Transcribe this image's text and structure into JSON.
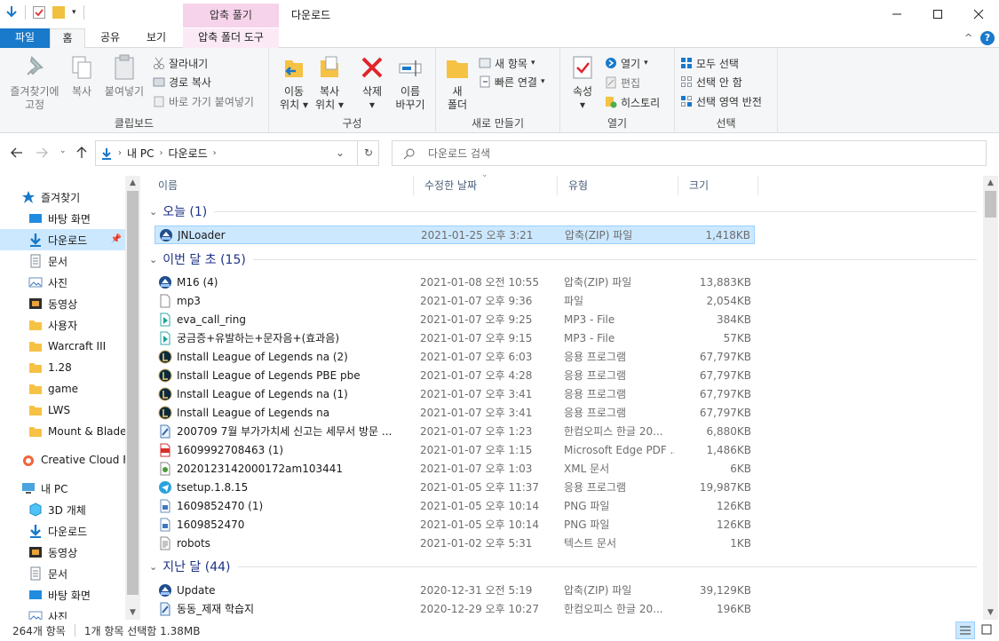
{
  "window": {
    "title": "다운로드",
    "context_tab_header": "압축 풀기"
  },
  "tabs": {
    "file": "파일",
    "home": "홈",
    "share": "공유",
    "view": "보기",
    "compressed_tools": "압축 폴더 도구"
  },
  "ribbon": {
    "clipboard": {
      "label": "클립보드",
      "pin_quick_1": "즐겨찾기에",
      "pin_quick_2": "고정",
      "copy": "복사",
      "paste": "붙여넣기",
      "cut": "잘라내기",
      "copy_path": "경로 복사",
      "paste_shortcut": "바로 가기 붙여넣기"
    },
    "organize": {
      "label": "구성",
      "move_to_1": "이동",
      "move_to_2": "위치",
      "copy_to_1": "복사",
      "copy_to_2": "위치",
      "delete": "삭제",
      "rename_1": "이름",
      "rename_2": "바꾸기"
    },
    "new": {
      "label": "새로 만들기",
      "new_folder_1": "새",
      "new_folder_2": "폴더",
      "new_item": "새 항목",
      "easy_access": "빠른 연결"
    },
    "open": {
      "label": "열기",
      "properties": "속성",
      "open": "열기",
      "edit": "편집",
      "history": "히스토리"
    },
    "select": {
      "label": "선택",
      "select_all": "모두 선택",
      "select_none": "선택 안 함",
      "invert": "선택 영역 반전"
    }
  },
  "address": {
    "this_pc": "내 PC",
    "downloads": "다운로드",
    "search_placeholder": "다운로드 검색"
  },
  "sidebar": {
    "quick_access": "즐겨찾기",
    "items": [
      {
        "label": "바탕 화면",
        "icon": "desktop-icon",
        "pinned": true
      },
      {
        "label": "다운로드",
        "icon": "download-icon",
        "pinned": true,
        "selected": true
      },
      {
        "label": "문서",
        "icon": "document-icon",
        "pinned": true
      },
      {
        "label": "사진",
        "icon": "picture-icon",
        "pinned": true
      },
      {
        "label": "동영상",
        "icon": "video-icon",
        "pinned": true
      },
      {
        "label": "사용자",
        "icon": "folder-icon",
        "pinned": true
      },
      {
        "label": "Warcraft III",
        "icon": "folder-icon",
        "pinned": true
      },
      {
        "label": "1.28",
        "icon": "folder-icon"
      },
      {
        "label": "game",
        "icon": "folder-icon"
      },
      {
        "label": "LWS",
        "icon": "folder-icon"
      },
      {
        "label": "Mount & Blade",
        "icon": "folder-icon"
      }
    ],
    "creative_cloud": "Creative Cloud Fil",
    "this_pc": "내 PC",
    "pc_items": [
      {
        "label": "3D 개체",
        "icon": "3d-objects-icon"
      },
      {
        "label": "다운로드",
        "icon": "download-icon"
      },
      {
        "label": "동영상",
        "icon": "video-icon"
      },
      {
        "label": "문서",
        "icon": "document-icon"
      },
      {
        "label": "바탕 화면",
        "icon": "desktop-icon"
      },
      {
        "label": "사진",
        "icon": "picture-icon"
      }
    ]
  },
  "columns": {
    "name": "이름",
    "date": "수정한 날짜",
    "type": "유형",
    "size": "크기"
  },
  "groups": [
    {
      "label": "오늘 (1)"
    },
    {
      "label": "이번 달 초 (15)"
    },
    {
      "label": "지난 달 (44)"
    }
  ],
  "files_today": [
    {
      "name": "JNLoader",
      "date": "2021-01-25 오후 3:21",
      "type": "압축(ZIP) 파일",
      "size": "1,418KB",
      "icon": "zip-icon"
    }
  ],
  "files_month": [
    {
      "name": "M16 (4)",
      "date": "2021-01-08 오전 10:55",
      "type": "압축(ZIP) 파일",
      "size": "13,883KB",
      "icon": "zip-icon"
    },
    {
      "name": "mp3",
      "date": "2021-01-07 오후 9:36",
      "type": "파일",
      "size": "2,054KB",
      "icon": "blank-file-icon"
    },
    {
      "name": "eva_call_ring",
      "date": "2021-01-07 오후 9:25",
      "type": "MP3 - File",
      "size": "384KB",
      "icon": "audio-file-icon"
    },
    {
      "name": "궁금증+유발하는+문자음+(효과음)",
      "date": "2021-01-07 오후 9:15",
      "type": "MP3 - File",
      "size": "57KB",
      "icon": "audio-file-icon"
    },
    {
      "name": "Install League of Legends na (2)",
      "date": "2021-01-07 오후 6:03",
      "type": "응용 프로그램",
      "size": "67,797KB",
      "icon": "lol-icon"
    },
    {
      "name": "Install League of Legends PBE pbe",
      "date": "2021-01-07 오후 4:28",
      "type": "응용 프로그램",
      "size": "67,797KB",
      "icon": "lol-icon"
    },
    {
      "name": "Install League of Legends na (1)",
      "date": "2021-01-07 오후 3:41",
      "type": "응용 프로그램",
      "size": "67,797KB",
      "icon": "lol-icon"
    },
    {
      "name": "Install League of Legends na",
      "date": "2021-01-07 오후 3:41",
      "type": "응용 프로그램",
      "size": "67,797KB",
      "icon": "lol-icon"
    },
    {
      "name": "200709  7월 부가가치세 신고는 세무서 방문 ...",
      "date": "2021-01-07 오후 1:23",
      "type": "한컴오피스 한글 20...",
      "size": "6,880KB",
      "icon": "hwp-icon"
    },
    {
      "name": "1609992708463 (1)",
      "date": "2021-01-07 오후 1:15",
      "type": "Microsoft Edge PDF ...",
      "size": "1,486KB",
      "icon": "pdf-icon"
    },
    {
      "name": "2020123142000172am103441",
      "date": "2021-01-07 오후 1:03",
      "type": "XML 문서",
      "size": "6KB",
      "icon": "xml-icon"
    },
    {
      "name": "tsetup.1.8.15",
      "date": "2021-01-05 오후 11:37",
      "type": "응용 프로그램",
      "size": "19,987KB",
      "icon": "telegram-icon"
    },
    {
      "name": "1609852470 (1)",
      "date": "2021-01-05 오후 10:14",
      "type": "PNG 파일",
      "size": "126KB",
      "icon": "image-file-icon"
    },
    {
      "name": "1609852470",
      "date": "2021-01-05 오후 10:14",
      "type": "PNG 파일",
      "size": "126KB",
      "icon": "image-file-icon"
    },
    {
      "name": "robots",
      "date": "2021-01-02 오후 5:31",
      "type": "텍스트 문서",
      "size": "1KB",
      "icon": "text-file-icon"
    }
  ],
  "files_last_month": [
    {
      "name": "Update",
      "date": "2020-12-31 오전 5:19",
      "type": "압축(ZIP) 파일",
      "size": "39,129KB",
      "icon": "zip-icon"
    },
    {
      "name": "동동_제재 학습지",
      "date": "2020-12-29 오후 10:27",
      "type": "한컴오피스 한글 20...",
      "size": "196KB",
      "icon": "hwp-icon"
    }
  ],
  "status": {
    "count": "264개 항목",
    "selection": "1개 항목 선택함 1.38MB"
  },
  "colors": {
    "accent": "#1979ca",
    "selection": "#cce8ff",
    "group_text": "#1e3287",
    "context_tab": "#f6d3ea"
  }
}
